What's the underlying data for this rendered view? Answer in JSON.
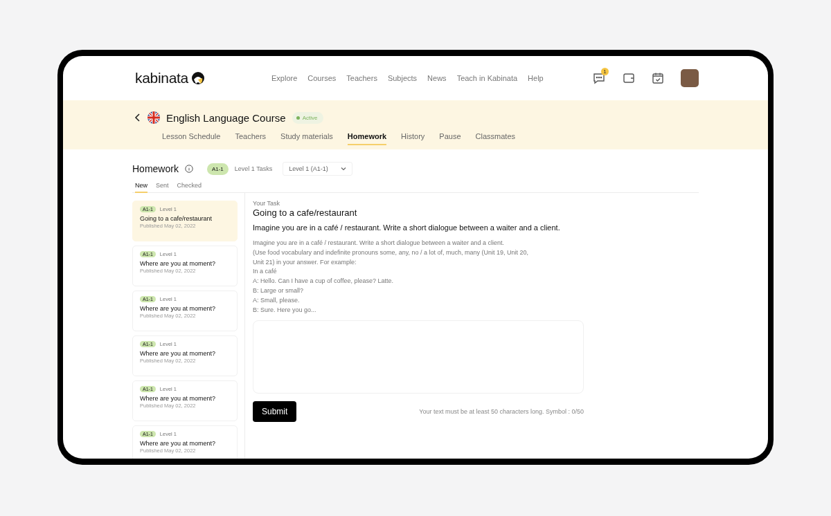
{
  "header": {
    "logo": "kabinata",
    "nav": [
      "Explore",
      "Courses",
      "Teachers",
      "Subjects",
      "News",
      "Teach in Kabinata",
      "Help"
    ],
    "notification_count": "1"
  },
  "course": {
    "title": "English Language Course",
    "status": "Active",
    "tabs": [
      {
        "label": "Lesson Schedule",
        "selected": false
      },
      {
        "label": "Teachers",
        "selected": false
      },
      {
        "label": "Study materials",
        "selected": false
      },
      {
        "label": "Homework",
        "selected": true
      },
      {
        "label": "History",
        "selected": false
      },
      {
        "label": "Pause",
        "selected": false
      },
      {
        "label": "Classmates",
        "selected": false
      }
    ]
  },
  "homework": {
    "title": "Homework",
    "level_badge": "A1-1",
    "level_label": "Level 1 Tasks",
    "level_select": "Level 1 (A1-1)",
    "subtabs": [
      {
        "label": "New",
        "selected": true
      },
      {
        "label": "Sent",
        "selected": false
      },
      {
        "label": "Checked",
        "selected": false
      }
    ],
    "tasks": [
      {
        "badge": "A1-1",
        "level": "Level 1",
        "title": "Going to a cafe/restaurant",
        "date": "Published May 02, 2022",
        "selected": true
      },
      {
        "badge": "A1-1",
        "level": "Level 1",
        "title": "Where are you at moment?",
        "date": "Published May 02, 2022",
        "selected": false
      },
      {
        "badge": "A1-1",
        "level": "Level 1",
        "title": "Where are you at moment?",
        "date": "Published May 02, 2022",
        "selected": false
      },
      {
        "badge": "A1-1",
        "level": "Level 1",
        "title": "Where are you at moment?",
        "date": "Published May 02, 2022",
        "selected": false
      },
      {
        "badge": "A1-1",
        "level": "Level 1",
        "title": "Where are you at moment?",
        "date": "Published May 02, 2022",
        "selected": false
      },
      {
        "badge": "A1-1",
        "level": "Level 1",
        "title": "Where are you at moment?",
        "date": "Published May 02, 2022",
        "selected": false
      }
    ],
    "detail": {
      "caption": "Your Task",
      "title": "Going to a cafe/restaurant",
      "summary": "Imagine you are in a café / restaurant. Write a short dialogue between a waiter and a client.",
      "lines": [
        "Imagine you are in a café / restaurant. Write a short dialogue between a waiter and a client.",
        "(Use food vocabulary and indefinite pronouns some, any, no / a lot of, much, many (Unit 19, Unit 20,",
        "Unit 21) in your answer. For example:",
        "In a café",
        "A: Hello. Can I have a cup of coffee, please? Latte.",
        "B: Large or small?",
        "A:  Small, please.",
        "B: Sure. Here you go..."
      ],
      "submit": "Submit",
      "hint": "Your text must be at least 50 characters long. Symbol : 0/50"
    }
  }
}
